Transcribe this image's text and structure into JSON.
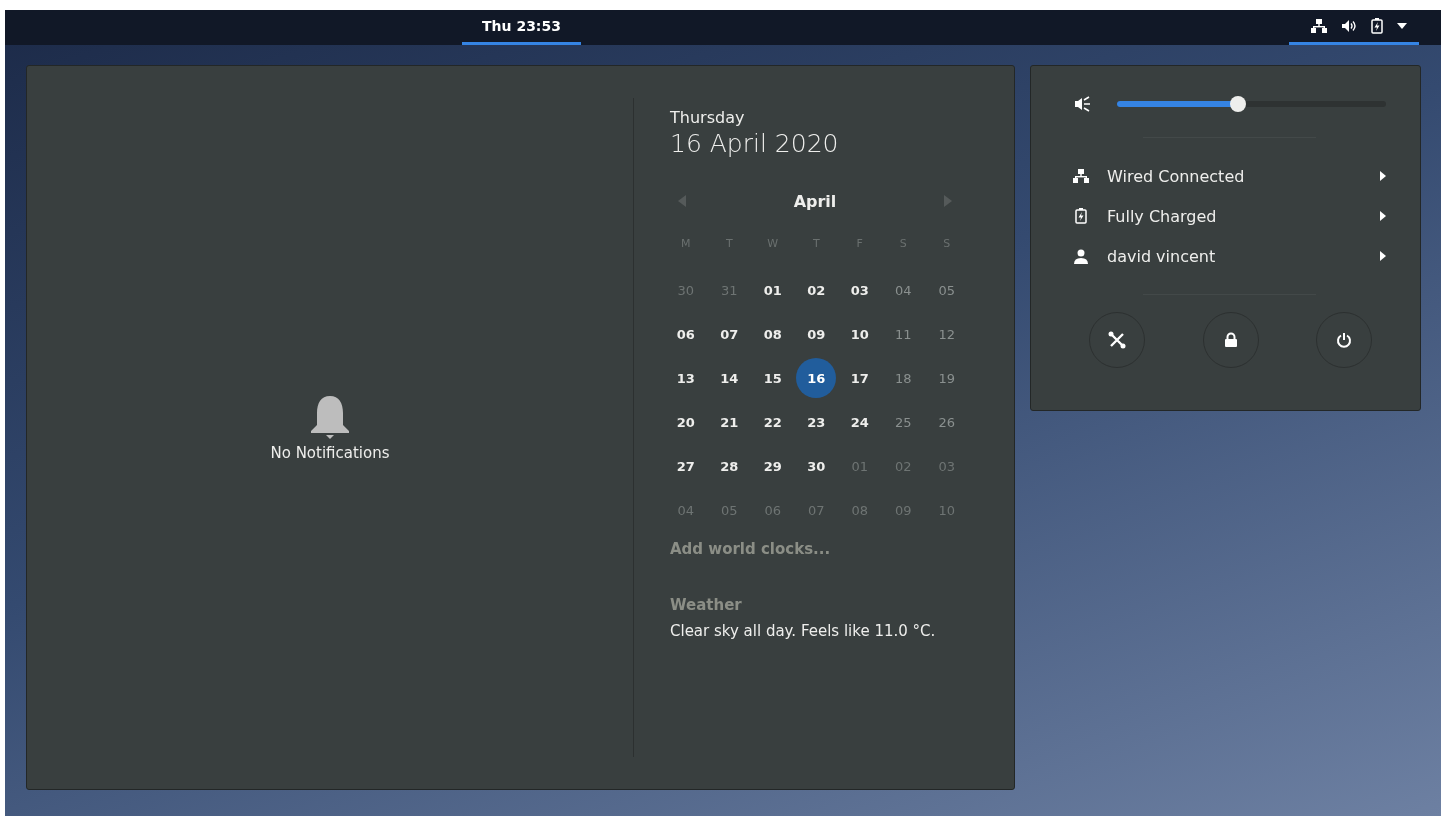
{
  "top_bar": {
    "clock": {
      "label": "Thu 23:53",
      "selected": true
    },
    "system_menu": {
      "selected": true
    }
  },
  "notifications": {
    "empty_text": "No Notifications"
  },
  "calendar": {
    "weekday": "Thursday",
    "date": "16 April 2020",
    "month": "April",
    "weekdays": [
      "M",
      "T",
      "W",
      "T",
      "F",
      "S",
      "S"
    ],
    "weeks": [
      [
        {
          "day": "30",
          "kind": "outside",
          "selected": false
        },
        {
          "day": "31",
          "kind": "outside",
          "selected": false
        },
        {
          "day": "01",
          "kind": "normal",
          "selected": false
        },
        {
          "day": "02",
          "kind": "normal",
          "selected": false
        },
        {
          "day": "03",
          "kind": "normal",
          "selected": false
        },
        {
          "day": "04",
          "kind": "weekend",
          "selected": false
        },
        {
          "day": "05",
          "kind": "weekend",
          "selected": false
        }
      ],
      [
        {
          "day": "06",
          "kind": "normal",
          "selected": false
        },
        {
          "day": "07",
          "kind": "normal",
          "selected": false
        },
        {
          "day": "08",
          "kind": "normal",
          "selected": false
        },
        {
          "day": "09",
          "kind": "normal",
          "selected": false
        },
        {
          "day": "10",
          "kind": "normal",
          "selected": false
        },
        {
          "day": "11",
          "kind": "weekend",
          "selected": false
        },
        {
          "day": "12",
          "kind": "weekend",
          "selected": false
        }
      ],
      [
        {
          "day": "13",
          "kind": "normal",
          "selected": false
        },
        {
          "day": "14",
          "kind": "normal",
          "selected": false
        },
        {
          "day": "15",
          "kind": "normal",
          "selected": false
        },
        {
          "day": "16",
          "kind": "normal",
          "selected": true
        },
        {
          "day": "17",
          "kind": "normal",
          "selected": false
        },
        {
          "day": "18",
          "kind": "weekend",
          "selected": false
        },
        {
          "day": "19",
          "kind": "weekend",
          "selected": false
        }
      ],
      [
        {
          "day": "20",
          "kind": "normal",
          "selected": false
        },
        {
          "day": "21",
          "kind": "normal",
          "selected": false
        },
        {
          "day": "22",
          "kind": "normal",
          "selected": false
        },
        {
          "day": "23",
          "kind": "normal",
          "selected": false
        },
        {
          "day": "24",
          "kind": "normal",
          "selected": false
        },
        {
          "day": "25",
          "kind": "weekend",
          "selected": false
        },
        {
          "day": "26",
          "kind": "weekend",
          "selected": false
        }
      ],
      [
        {
          "day": "27",
          "kind": "normal",
          "selected": false
        },
        {
          "day": "28",
          "kind": "normal",
          "selected": false
        },
        {
          "day": "29",
          "kind": "normal",
          "selected": false
        },
        {
          "day": "30",
          "kind": "normal",
          "selected": false
        },
        {
          "day": "01",
          "kind": "outside",
          "selected": false
        },
        {
          "day": "02",
          "kind": "outside",
          "selected": false
        },
        {
          "day": "03",
          "kind": "outside",
          "selected": false
        }
      ],
      [
        {
          "day": "04",
          "kind": "outside",
          "selected": false
        },
        {
          "day": "05",
          "kind": "outside",
          "selected": false
        },
        {
          "day": "06",
          "kind": "outside",
          "selected": false
        },
        {
          "day": "07",
          "kind": "outside",
          "selected": false
        },
        {
          "day": "08",
          "kind": "outside",
          "selected": false
        },
        {
          "day": "09",
          "kind": "outside",
          "selected": false
        },
        {
          "day": "10",
          "kind": "outside",
          "selected": false
        }
      ]
    ],
    "world_clocks": "Add world clocks...",
    "weather_title": "Weather",
    "weather_text": "Clear sky all day. Feels like 11.0 °C."
  },
  "system_menu": {
    "volume": {
      "level": 0.45
    },
    "items": [
      {
        "kind": "network",
        "label": "Wired Connected"
      },
      {
        "kind": "battery",
        "label": "Fully Charged"
      },
      {
        "kind": "user",
        "label": "david vincent"
      }
    ],
    "buttons": [
      {
        "kind": "settings"
      },
      {
        "kind": "lock"
      },
      {
        "kind": "power"
      }
    ]
  }
}
